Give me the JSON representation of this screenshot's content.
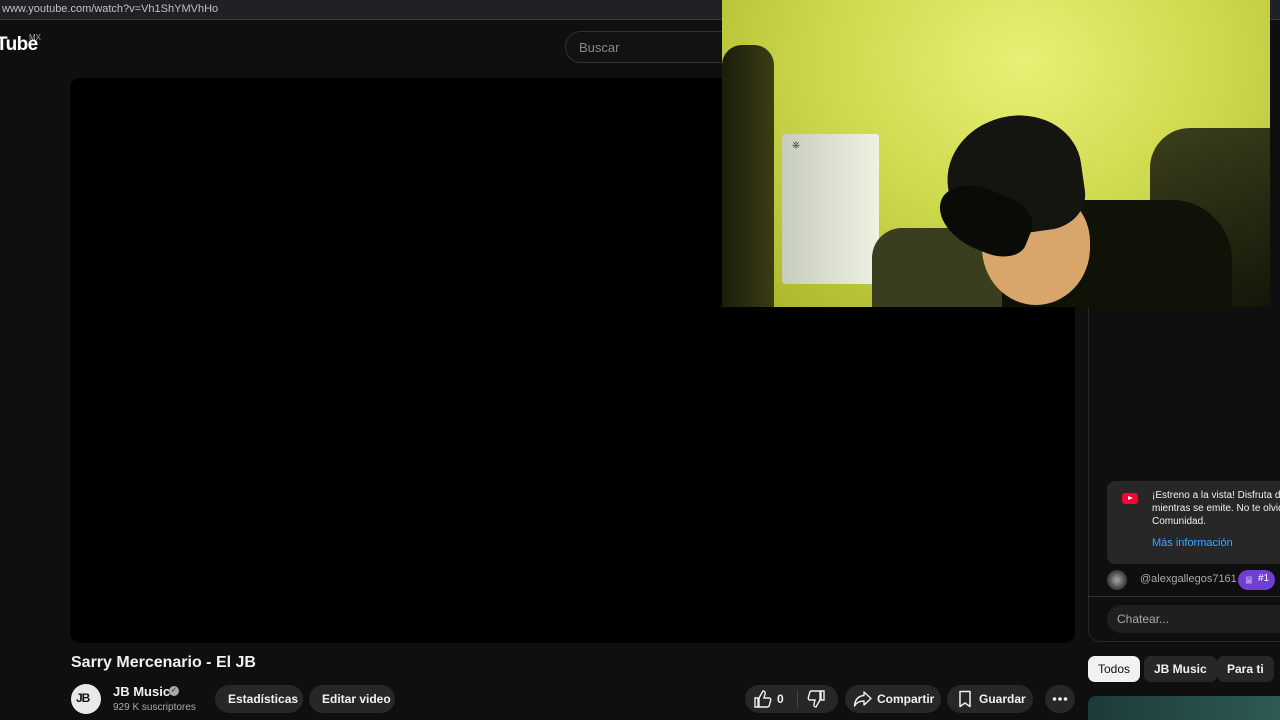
{
  "browser": {
    "url": "www.youtube.com/watch?v=Vh1ShYMVhHo"
  },
  "masthead": {
    "logo_text": "Tube",
    "region": "MX",
    "search_placeholder": "Buscar"
  },
  "video": {
    "title": "Sarry Mercenario - El JB",
    "channel": {
      "avatar_text": "JB",
      "name": "JB Music",
      "subscribers": "929 K suscriptores"
    },
    "actions": {
      "stats_label": "Estadísticas",
      "edit_label": "Editar video",
      "like_count": "0",
      "share_label": "Compartir",
      "save_label": "Guardar"
    }
  },
  "chat": {
    "premiere_notice": {
      "line1": "¡Estreno a la vista! Disfruta de",
      "line2": "mientras se emite. No te olvid",
      "line3": "Comunidad.",
      "link": "Más información"
    },
    "message": {
      "author": "@alexgallegos7161",
      "badge": "#1"
    },
    "input_placeholder": "Chatear..."
  },
  "recommendation_chips": [
    "Todos",
    "JB Music",
    "Para ti"
  ],
  "webcam_overlay": {
    "console_logo": "⎈"
  },
  "colors": {
    "background": "#0f0f0f",
    "surface": "#272727",
    "accent_link": "#3ea6ff",
    "badge_purple": "#6f3fd1",
    "yt_red": "#ff0033"
  }
}
